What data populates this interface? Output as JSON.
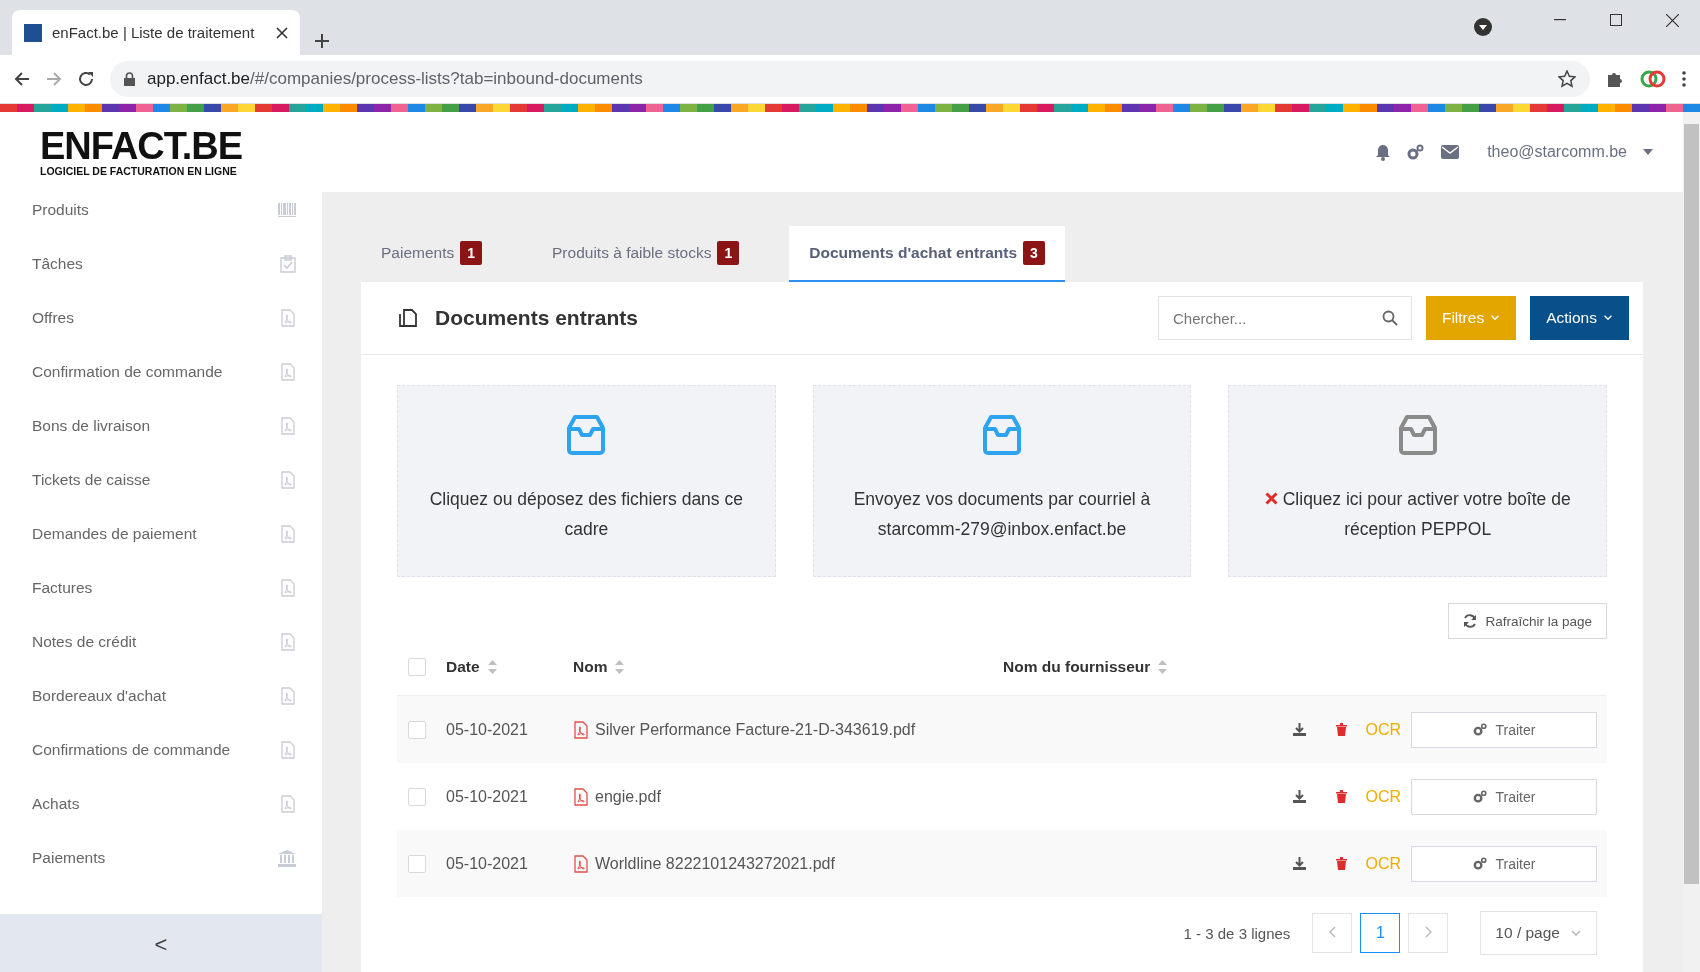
{
  "browser": {
    "tab_title": "enFact.be | Liste de traitement",
    "url_host": "app.enfact.be",
    "url_path": "/#/companies/process-lists?tab=inbound-documents"
  },
  "header": {
    "logo": "ENFACT.BE",
    "tagline": "LOGICIEL DE FACTURATION EN LIGNE",
    "user": "theo@starcomm.be"
  },
  "sidebar": {
    "items": [
      {
        "label": "Produits",
        "kind": "barcode"
      },
      {
        "label": "Tâches",
        "kind": "task"
      },
      {
        "label": "Offres",
        "kind": "document"
      },
      {
        "label": "Confirmation de commande",
        "kind": "document"
      },
      {
        "label": "Bons de livraison",
        "kind": "document"
      },
      {
        "label": "Tickets de caisse",
        "kind": "document"
      },
      {
        "label": "Demandes de paiement",
        "kind": "document"
      },
      {
        "label": "Factures",
        "kind": "document"
      },
      {
        "label": "Notes de crédit",
        "kind": "document"
      },
      {
        "label": "Bordereaux d'achat",
        "kind": "document"
      },
      {
        "label": "Confirmations de commande",
        "kind": "document"
      },
      {
        "label": "Achats",
        "kind": "document"
      },
      {
        "label": "Paiements",
        "kind": "bank"
      }
    ],
    "collapse": "<"
  },
  "tabs": [
    {
      "label": "Paiements",
      "count": "1",
      "selected": false
    },
    {
      "label": "Produits à faible stocks",
      "count": "1",
      "selected": false
    },
    {
      "label": "Documents d'achat entrants",
      "count": "3",
      "selected": true
    }
  ],
  "panel": {
    "title": "Documents entrants",
    "search_placeholder": "Chercher...",
    "filters": "Filtres",
    "actions": "Actions"
  },
  "dropzones": [
    {
      "kind": "upload",
      "text": "Cliquez ou déposez des fichiers dans ce cadre"
    },
    {
      "kind": "email",
      "text": "Envoyez vos documents par courriel à starcomm-279@inbox.enfact.be"
    },
    {
      "kind": "peppol",
      "text": "Cliquez ici pour activer votre boîte de réception PEPPOL"
    }
  ],
  "refresh": "Rafraîchir la page",
  "table": {
    "select_all": {
      "checked": false
    },
    "columns": [
      "Date",
      "Nom",
      "Nom du fournisseur"
    ],
    "rows": [
      {
        "checked": false,
        "date": "05-10-2021",
        "name": "Silver Performance Facture-21-D-343619.pdf",
        "ocr": "OCR",
        "process": "Traiter"
      },
      {
        "checked": false,
        "date": "05-10-2021",
        "name": "engie.pdf",
        "ocr": "OCR",
        "process": "Traiter"
      },
      {
        "checked": false,
        "date": "05-10-2021",
        "name": "Worldline 8222101243272021.pdf",
        "ocr": "OCR",
        "process": "Traiter"
      }
    ]
  },
  "pagination": {
    "summary": "1 - 3 de 3 lignes",
    "pages": [
      {
        "label": "1",
        "selected": true
      }
    ],
    "page_size": "10 / page"
  }
}
